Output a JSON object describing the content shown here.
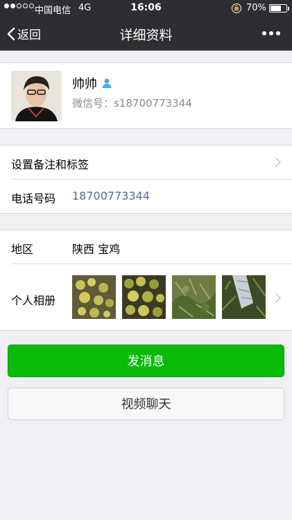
{
  "status_bar": {
    "carrier": "中国电信",
    "network": "4G",
    "time": "16:06",
    "battery_percent": "70%",
    "battery_level": 0.7,
    "signal_bars_filled": 2,
    "signal_bars_total": 5
  },
  "nav": {
    "back_label": "返回",
    "title": "详细资料"
  },
  "profile": {
    "name": "帅帅",
    "wechat_id": "微信号：s18700773344"
  },
  "rows": {
    "remark_tags": "设置备注和标签",
    "phone_label": "电话号码",
    "phone_value": "18700773344",
    "region_label": "地区",
    "region_value": "陕西 宝鸡",
    "album_label": "个人相册"
  },
  "buttons": {
    "send_message": "发消息",
    "video_chat": "视频聊天"
  },
  "colors": {
    "nav_bg": "#2e2e32",
    "primary_green": "#09bb07",
    "link_blue": "#576b95"
  }
}
